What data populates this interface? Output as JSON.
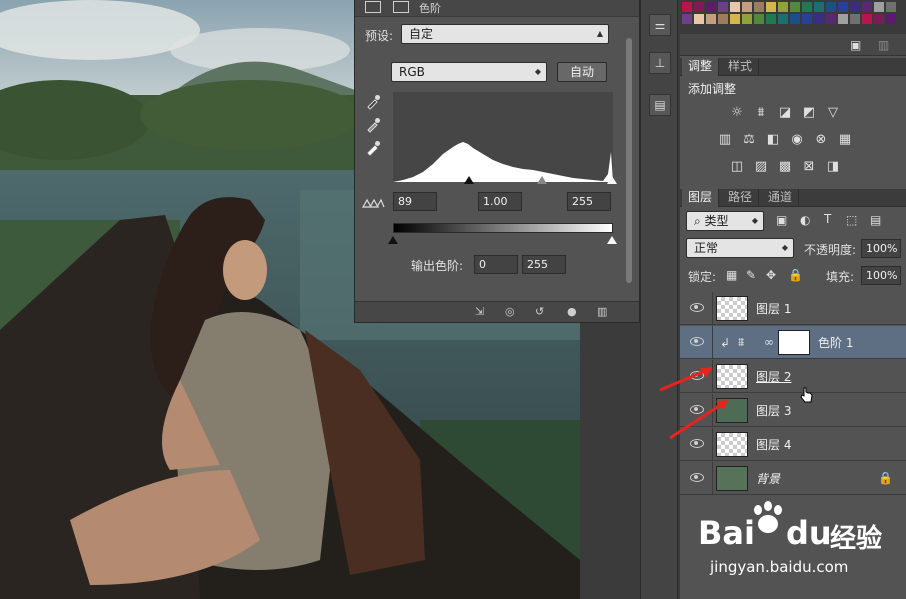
{
  "levels_panel": {
    "title": "色阶",
    "preset_label": "预设:",
    "preset_value": "自定",
    "channel_value": "RGB",
    "auto_button": "自动",
    "input_black": "89",
    "input_gamma": "1.00",
    "input_white": "255",
    "output_label": "输出色阶:",
    "output_black": "0",
    "output_white": "255"
  },
  "adjustments": {
    "tab_adjust": "调整",
    "tab_styles": "样式",
    "heading": "添加调整"
  },
  "layers_panel": {
    "tab_layers": "图层",
    "tab_paths": "路径",
    "tab_channels": "通道",
    "kind_filter": "类型",
    "blend_mode": "正常",
    "opacity_label": "不透明度:",
    "opacity_value": "100%",
    "lock_label": "锁定:",
    "fill_label": "填充:",
    "fill_value": "100%",
    "layers": [
      {
        "name": "图层 1"
      },
      {
        "name": "色阶 1"
      },
      {
        "name": "图层 2"
      },
      {
        "name": "图层 3"
      },
      {
        "name": "图层 4"
      },
      {
        "name": "背景"
      }
    ]
  },
  "watermark": {
    "brand_text": "Bai",
    "brand_text2": "du",
    "brand_cn": "经验",
    "url": "jingyan.baidu.com"
  },
  "colors": {
    "panel": "#535353",
    "selected_layer": "#5e6f84",
    "arrow_red": "#e8231e"
  }
}
